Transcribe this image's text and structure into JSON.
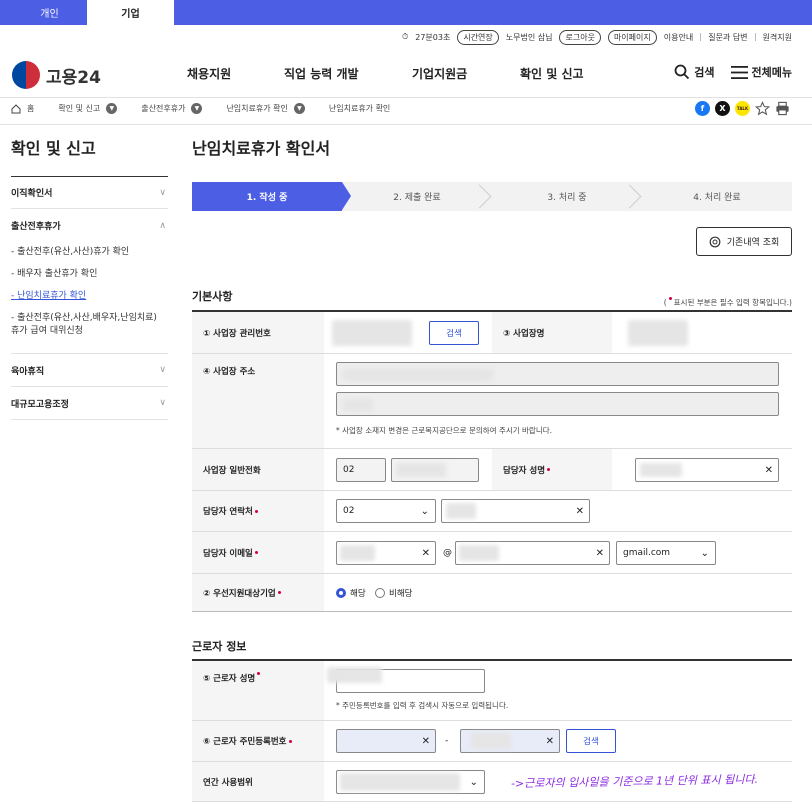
{
  "top_tabs": [
    "개인",
    "기업"
  ],
  "util": {
    "timer": "27분03초",
    "extend": "시간연장",
    "user": "노무법인 삼닙",
    "logout": "로그아웃",
    "mypage": "마이페이지",
    "guide": "이용안내",
    "qna": "질문과 답변",
    "remote": "원격지원"
  },
  "logo": "고용24",
  "gnb": [
    "채용지원",
    "직업 능력 개발",
    "기업지원금",
    "확인 및 신고"
  ],
  "right_menu": {
    "search": "검색",
    "all": "전체메뉴"
  },
  "breadcrumb": [
    "홈",
    "확인 및 신고",
    "출산전후휴가",
    "난임치료휴가 확인",
    "난임치료휴가 확인"
  ],
  "share_icons": [
    "f",
    "X",
    "TALK"
  ],
  "sidebar": {
    "title": "확인 및 신고",
    "items": [
      {
        "label": "이직확인서"
      },
      {
        "label": "출산전후휴가",
        "sub": [
          "- 출산전후(유산,사산)휴가 확인",
          "- 배우자 출산휴가 확인",
          "- 난임치료휴가 확인",
          "- 출산전후(유산,사산,배우자,난임치료) 휴가 급여 대위신청"
        ]
      },
      {
        "label": "육아휴직"
      },
      {
        "label": "대규모고용조정"
      }
    ]
  },
  "page": {
    "title": "난임치료휴가 확인서",
    "steps": [
      "1. 작성 중",
      "2. 제출 완료",
      "3. 처리 중",
      "4. 처리 완료"
    ],
    "history_button": "기존내역 조회",
    "section1": "기본사항",
    "required_note_a": "(",
    "required_note_b": "표시된 부분은 필수 입력 항목입니다.)",
    "labels": {
      "biz_no": "① 사업장 관리번호",
      "search": "검색",
      "biz_name": "③ 사업장명",
      "biz_addr": "④ 사업장 주소",
      "addr_hint": "* 사업장 소재지 변경은 근로복지공단으로 문의하여 주시기 바랍니다.",
      "phone": "사업장 일반전화",
      "phone_area": "02",
      "manager": "담당자 성명",
      "contact": "담당자 연락처",
      "contact_area": "02",
      "email": "담당자 이메일",
      "at": "@",
      "email_domain": "gmail.com",
      "priority": "② 우선지원대상기업",
      "yes": "해당",
      "no": "비해당"
    },
    "section2": "근로자 정보",
    "worker": {
      "name": "⑤ 근로자 성명",
      "name_hint": "* 주민등록번호를 입력 후 검색시 자동으로 입력됩니다.",
      "rrn": "⑥ 근로자 주민등록번호",
      "dash": "-",
      "search": "검색",
      "range": "연간 사용범위"
    }
  },
  "annotation": "->근로자의 입사일을 기준으로 1년 단위 표시 됩니다."
}
